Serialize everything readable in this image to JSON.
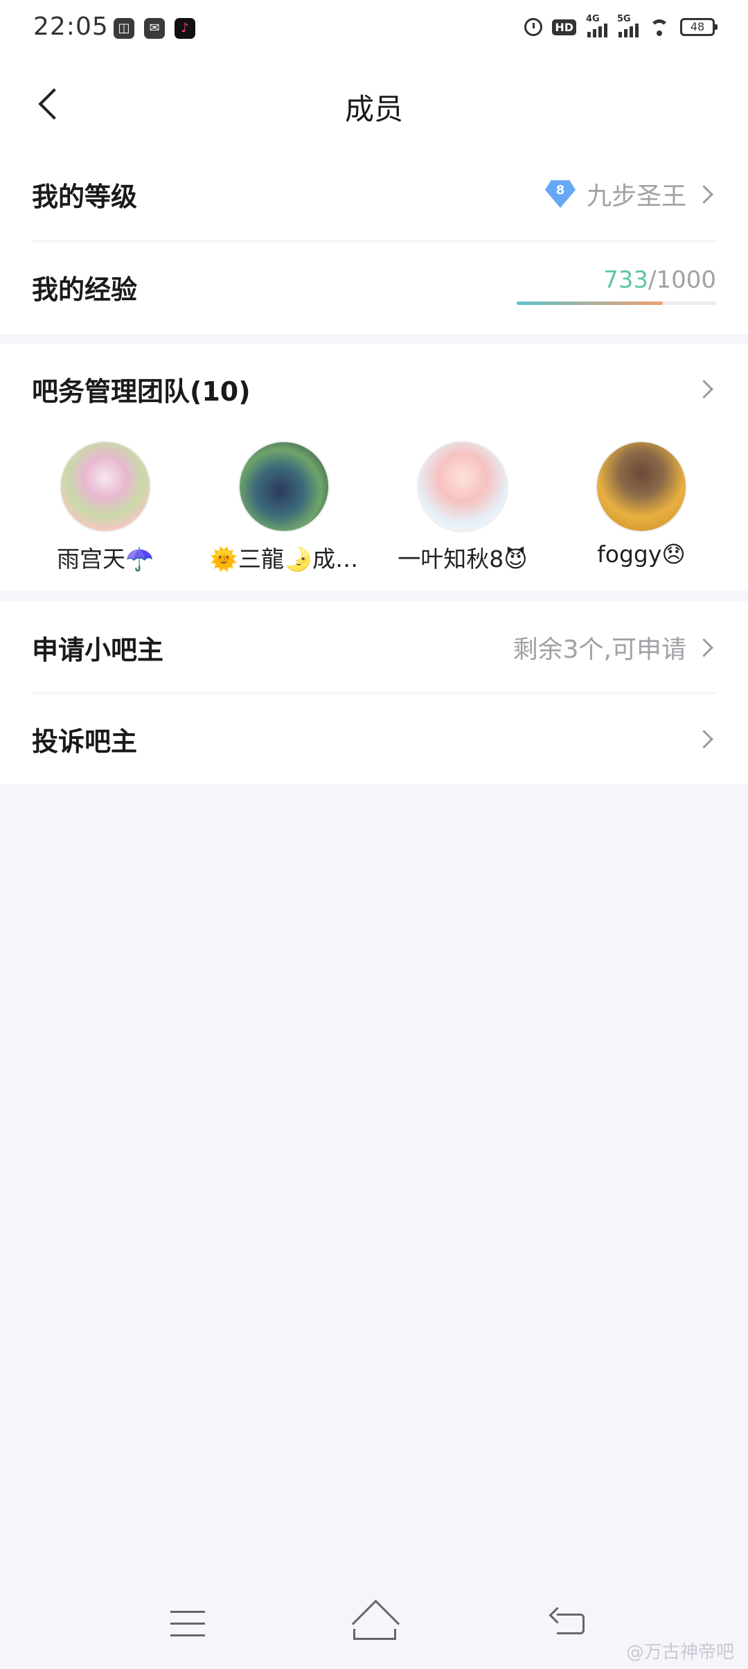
{
  "status_bar": {
    "time": "22:05",
    "app_icons": [
      "♪"
    ],
    "hd_label": "HD",
    "net1": "4G",
    "net2": "5G",
    "battery": "48"
  },
  "header": {
    "title": "成员"
  },
  "level": {
    "label": "我的等级",
    "badge_number": "8",
    "value": "九步圣王"
  },
  "experience": {
    "label": "我的经验",
    "current": "733",
    "total": "/1000",
    "progress_fraction": 0.733
  },
  "team": {
    "title": "吧务管理团队(10)",
    "members": [
      {
        "name": "雨宫天☂️"
      },
      {
        "name": "🌞三龍🌛成…"
      },
      {
        "name": "一叶知秋8😈"
      },
      {
        "name": "foggy😞"
      }
    ]
  },
  "apply": {
    "label": "申请小吧主",
    "value": "剩余3个,可申请"
  },
  "complain": {
    "label": "投诉吧主"
  },
  "watermark": "@万古神帝吧",
  "colors": {
    "accent_green": "#5ec6a8",
    "badge_blue": "#66a8f5",
    "page_bg": "#f5f6fc"
  }
}
